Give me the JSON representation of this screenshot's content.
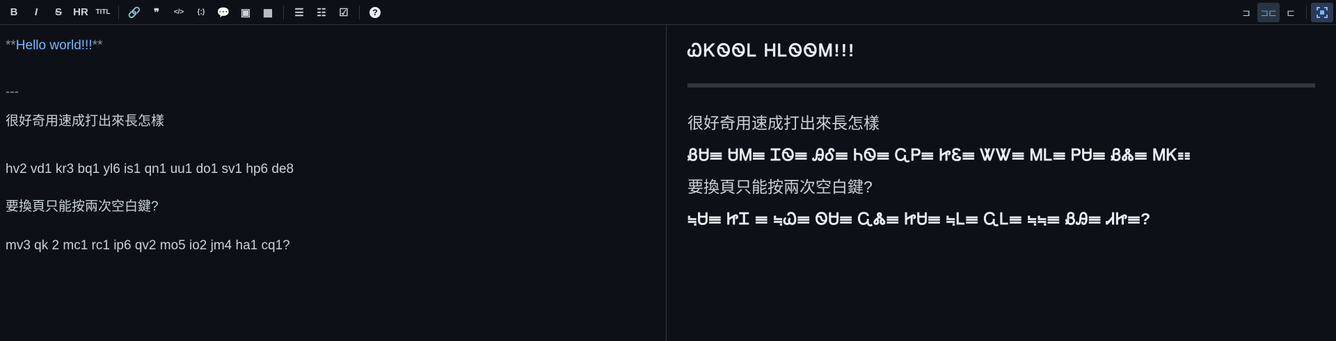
{
  "toolbar": {
    "left_groups": [
      [
        {
          "name": "bold-icon",
          "glyph": "B"
        },
        {
          "name": "italic-icon",
          "glyph": "I"
        },
        {
          "name": "strikethrough-icon",
          "glyph": "S"
        },
        {
          "name": "hr-icon",
          "glyph": "HR"
        },
        {
          "name": "title-icon",
          "glyph": "TITL"
        }
      ],
      [
        {
          "name": "link-icon",
          "glyph": "🔗"
        },
        {
          "name": "quote-icon",
          "glyph": "❞"
        },
        {
          "name": "code-icon",
          "glyph": "</>"
        },
        {
          "name": "code-block-icon",
          "glyph": "{;}"
        },
        {
          "name": "comment-icon",
          "glyph": "💬"
        },
        {
          "name": "image-icon",
          "glyph": "▣"
        },
        {
          "name": "table-icon",
          "glyph": "▦"
        }
      ],
      [
        {
          "name": "unordered-list-icon",
          "glyph": "☰"
        },
        {
          "name": "ordered-list-icon",
          "glyph": "☷"
        },
        {
          "name": "task-list-icon",
          "glyph": "☑"
        }
      ],
      [
        {
          "name": "help-icon",
          "glyph": "?"
        }
      ]
    ],
    "right_buttons": [
      {
        "name": "editor-only-icon",
        "glyph": "⊐"
      },
      {
        "name": "split-view-icon",
        "glyph": "⊐⊏",
        "active": true
      },
      {
        "name": "preview-only-icon",
        "glyph": "⊏"
      }
    ],
    "fullscreen_icon": "fullscreen-icon"
  },
  "editor": {
    "line1_prefix": "**",
    "line1_text": "Hello world!!!",
    "line1_suffix": "**",
    "hr_md": "---",
    "line_cjk1": "很好奇用速成打出來長怎樣",
    "line_codes1": "hv2 vd1 kr3 bq1 yl6 is1 qn1 uu1 do1 sv1 hp6 de8",
    "line_cjk2": "要換頁只能按兩次空白鍵?",
    "line_codes2": "mv3 qk 2 mc1 rc1 ip6 qv2 mo5 io2 jm4 ha1 cq1?"
  },
  "preview": {
    "heading": "ᏇᏦᏫᏫᏞ ᎻᏞᏫᏫᎷ!!!",
    "p_cjk1": "很好奇用速成打出來長怎樣",
    "p_glyph1": "ᏰᏌ☰ ᏌᎷ☰ ᏆᏫ☰ ᎯᎴ☰ ᏂᏫ☰ ᏩᏢ☰ ᏥᏋ☰ ᏔᏔ☰ ᎷᏞ☰ ᏢᏌ☰ ᏰᏜ☰ ᎷᏦ☷",
    "p_cjk2": "要換頁只能按兩次空白鍵?",
    "p_glyph2": "≒Ꮜ☰ ᏥᏆ ☰ ≒Ꮗ☰ ᏫᏌ☰ ᏩᏜ☰ ᏥᏌ☰ ≒Ꮮ☰ ᏩᏞ☰ ≒≒☰ ᏰᎯ☰ ᏗᏥ☰?"
  }
}
